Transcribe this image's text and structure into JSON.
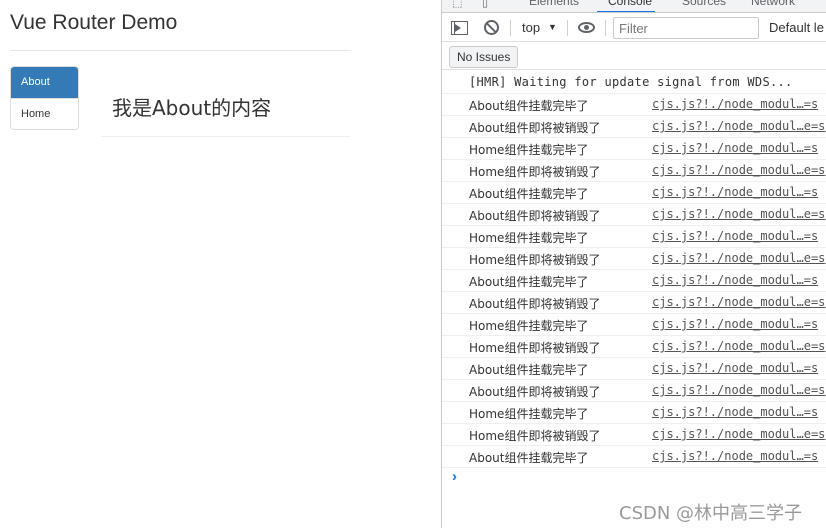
{
  "app": {
    "title": "Vue Router Demo",
    "nav": [
      {
        "label": "About",
        "active": true
      },
      {
        "label": "Home",
        "active": false
      }
    ],
    "content": "我是About的内容",
    "accent_color": "#337ab7"
  },
  "devtools": {
    "tabs": [
      {
        "label": "Elements",
        "active": false
      },
      {
        "label": "Console",
        "active": true
      },
      {
        "label": "Sources",
        "active": false
      },
      {
        "label": "Network",
        "active": false
      }
    ],
    "toolbar": {
      "context": "top",
      "filter_placeholder": "Filter",
      "levels": "Default le"
    },
    "issues_label": "No Issues",
    "console": [
      {
        "message": "[HMR] Waiting for update signal from WDS...",
        "source": ""
      },
      {
        "message": "About组件挂载完毕了",
        "source": "cjs.js?!./node_modul…=s"
      },
      {
        "message": "About组件即将被销毁了",
        "source": "cjs.js?!./node_modul…e=s"
      },
      {
        "message": "Home组件挂载完毕了",
        "source": "cjs.js?!./node_modul…=s"
      },
      {
        "message": "Home组件即将被销毁了",
        "source": "cjs.js?!./node_modul…e=s"
      },
      {
        "message": "About组件挂载完毕了",
        "source": "cjs.js?!./node_modul…=s"
      },
      {
        "message": "About组件即将被销毁了",
        "source": "cjs.js?!./node_modul…e=s"
      },
      {
        "message": "Home组件挂载完毕了",
        "source": "cjs.js?!./node_modul…=s"
      },
      {
        "message": "Home组件即将被销毁了",
        "source": "cjs.js?!./node_modul…e=s"
      },
      {
        "message": "About组件挂载完毕了",
        "source": "cjs.js?!./node_modul…=s"
      },
      {
        "message": "About组件即将被销毁了",
        "source": "cjs.js?!./node_modul…e=s"
      },
      {
        "message": "Home组件挂载完毕了",
        "source": "cjs.js?!./node_modul…=s"
      },
      {
        "message": "Home组件即将被销毁了",
        "source": "cjs.js?!./node_modul…e=s"
      },
      {
        "message": "About组件挂载完毕了",
        "source": "cjs.js?!./node_modul…=s"
      },
      {
        "message": "About组件即将被销毁了",
        "source": "cjs.js?!./node_modul…e=s"
      },
      {
        "message": "Home组件挂载完毕了",
        "source": "cjs.js?!./node_modul…=s"
      },
      {
        "message": "Home组件即将被销毁了",
        "source": "cjs.js?!./node_modul…e=s"
      },
      {
        "message": "About组件挂载完毕了",
        "source": "cjs.js?!./node_modul…=s"
      }
    ]
  },
  "watermark": "CSDN @林中高三学子"
}
